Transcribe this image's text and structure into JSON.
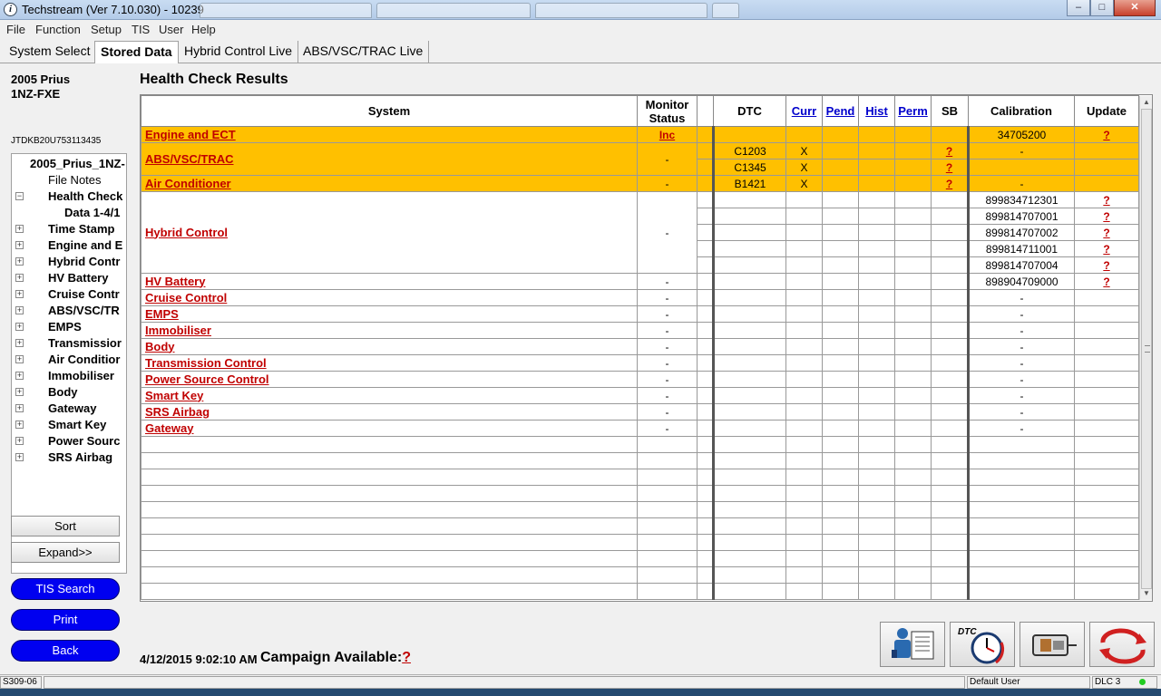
{
  "window": {
    "title": "Techstream (Ver 7.10.030) - 10239",
    "minimize": "‒",
    "maximize": "□",
    "close": "✕"
  },
  "menu": [
    "File",
    "Function",
    "Setup",
    "TIS",
    "User",
    "Help"
  ],
  "tabs": [
    "System Select",
    "Stored Data",
    "Hybrid Control Live",
    "ABS/VSC/TRAC Live"
  ],
  "active_tab": "Stored Data",
  "vehicle": {
    "model": "2005 Prius",
    "engine": "1NZ-FXE",
    "vin": "JTDKB20U753113435"
  },
  "tree": [
    {
      "label": "2005_Prius_1NZ-",
      "exp": ""
    },
    {
      "label": "File Notes",
      "exp": ""
    },
    {
      "label": "Health Check",
      "exp": "−"
    },
    {
      "label": "Data 1-4/1",
      "exp": ""
    },
    {
      "label": "Time Stamp",
      "exp": "+"
    },
    {
      "label": "Engine and E",
      "exp": "+"
    },
    {
      "label": "Hybrid Contr",
      "exp": "+"
    },
    {
      "label": "HV Battery",
      "exp": "+"
    },
    {
      "label": "Cruise Contr",
      "exp": "+"
    },
    {
      "label": "ABS/VSC/TR",
      "exp": "+"
    },
    {
      "label": "EMPS",
      "exp": "+"
    },
    {
      "label": "Transmissior",
      "exp": "+"
    },
    {
      "label": "Air Conditior",
      "exp": "+"
    },
    {
      "label": "Immobiliser",
      "exp": "+"
    },
    {
      "label": "Body",
      "exp": "+"
    },
    {
      "label": "Gateway",
      "exp": "+"
    },
    {
      "label": "Smart Key",
      "exp": "+"
    },
    {
      "label": "Power Sourc",
      "exp": "+"
    },
    {
      "label": "SRS Airbag",
      "exp": "+"
    }
  ],
  "left_buttons": {
    "sort": "Sort",
    "expand": "Expand>>",
    "tis_search": "TIS Search",
    "print": "Print",
    "back": "Back"
  },
  "main": {
    "title": "Health Check Results"
  },
  "table": {
    "headers": {
      "system": "System",
      "monitor_line1": "Monitor",
      "monitor_line2": "Status",
      "dtc": "DTC",
      "curr": "Curr",
      "pend": "Pend",
      "hist": "Hist",
      "perm": "Perm",
      "sb": "SB",
      "calibration": "Calibration",
      "update": "Update"
    },
    "rows": [
      {
        "system": "Engine and ECT",
        "monitor": "Inc",
        "dtc": "",
        "curr": "",
        "sb": "",
        "cal": "34705200",
        "update": "?",
        "highlight": true
      },
      {
        "system": "ABS/VSC/TRAC",
        "monitor": "-",
        "dtc": "C1203",
        "curr": "X",
        "sb": "?",
        "cal": "-",
        "update": "",
        "highlight": true
      },
      {
        "system": "",
        "monitor": "",
        "dtc": "C1345",
        "curr": "X",
        "sb": "?",
        "cal": "",
        "update": "",
        "highlight": true
      },
      {
        "system": "Air Conditioner",
        "monitor": "-",
        "dtc": "B1421",
        "curr": "X",
        "sb": "?",
        "cal": "-",
        "update": "",
        "highlight": true
      },
      {
        "system": "",
        "monitor": "",
        "dtc": "",
        "curr": "",
        "sb": "",
        "cal": "899834712301",
        "update": "?",
        "highlight": false
      },
      {
        "system": "",
        "monitor": "",
        "dtc": "",
        "curr": "",
        "sb": "",
        "cal": "899814707001",
        "update": "?",
        "highlight": false
      },
      {
        "system": "Hybrid Control",
        "monitor": "-",
        "dtc": "",
        "curr": "",
        "sb": "",
        "cal": "899814707002",
        "update": "?",
        "highlight": false
      },
      {
        "system": "",
        "monitor": "",
        "dtc": "",
        "curr": "",
        "sb": "",
        "cal": "899814711001",
        "update": "?",
        "highlight": false
      },
      {
        "system": "",
        "monitor": "",
        "dtc": "",
        "curr": "",
        "sb": "",
        "cal": "899814707004",
        "update": "?",
        "highlight": false
      },
      {
        "system": "HV Battery",
        "monitor": "-",
        "dtc": "",
        "curr": "",
        "sb": "",
        "cal": "898904709000",
        "update": "?",
        "highlight": false
      },
      {
        "system": "Cruise Control",
        "monitor": "-",
        "dtc": "",
        "curr": "",
        "sb": "",
        "cal": "-",
        "update": "",
        "highlight": false
      },
      {
        "system": "EMPS",
        "monitor": "-",
        "dtc": "",
        "curr": "",
        "sb": "",
        "cal": "-",
        "update": "",
        "highlight": false
      },
      {
        "system": "Immobiliser",
        "monitor": "-",
        "dtc": "",
        "curr": "",
        "sb": "",
        "cal": "-",
        "update": "",
        "highlight": false
      },
      {
        "system": "Body",
        "monitor": "-",
        "dtc": "",
        "curr": "",
        "sb": "",
        "cal": "-",
        "update": "",
        "highlight": false
      },
      {
        "system": "Transmission Control",
        "monitor": "-",
        "dtc": "",
        "curr": "",
        "sb": "",
        "cal": "-",
        "update": "",
        "highlight": false
      },
      {
        "system": "Power Source Control",
        "monitor": "-",
        "dtc": "",
        "curr": "",
        "sb": "",
        "cal": "-",
        "update": "",
        "highlight": false
      },
      {
        "system": "Smart Key",
        "monitor": "-",
        "dtc": "",
        "curr": "",
        "sb": "",
        "cal": "-",
        "update": "",
        "highlight": false
      },
      {
        "system": "SRS Airbag",
        "monitor": "-",
        "dtc": "",
        "curr": "",
        "sb": "",
        "cal": "-",
        "update": "",
        "highlight": false
      },
      {
        "system": "Gateway",
        "monitor": "-",
        "dtc": "",
        "curr": "",
        "sb": "",
        "cal": "-",
        "update": "",
        "highlight": false
      }
    ],
    "empty_rows": 10
  },
  "footer": {
    "datetime": "4/12/2015 9:02:10 AM",
    "campaign_label": "Campaign Available:",
    "campaign_value": "?"
  },
  "toolbar": {
    "dtc_label": "DTC"
  },
  "statusbar": {
    "code": "S309-06",
    "user": "Default User",
    "dlc": "DLC 3"
  },
  "colors": {
    "highlight": "#ffc000",
    "link_red": "#c00000",
    "button_blue": "#0000f0"
  }
}
